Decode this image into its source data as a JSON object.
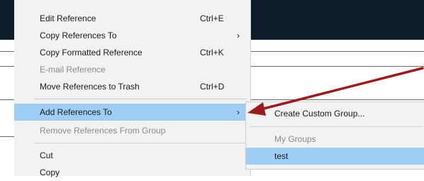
{
  "menu": {
    "items": [
      {
        "label": "Edit Reference",
        "shortcut": "Ctrl+E"
      },
      {
        "label": "Copy References To",
        "arrow": "›"
      },
      {
        "label": "Copy Formatted Reference",
        "shortcut": "Ctrl+K"
      },
      {
        "label": "E-mail Reference"
      },
      {
        "label": "Move References to Trash",
        "shortcut": "Ctrl+D"
      },
      {
        "label": "Add References To",
        "arrow": "›"
      },
      {
        "label": "Remove References From Group"
      },
      {
        "label": "Cut"
      },
      {
        "label": "Copy"
      }
    ]
  },
  "submenu": {
    "items": [
      {
        "label": "Create Custom Group..."
      },
      {
        "label": "My Groups"
      },
      {
        "label": "test"
      }
    ]
  },
  "colors": {
    "highlight": "#9fcdf3",
    "annotation_arrow": "#9b1c1c",
    "header_bar": "#0d1b2a"
  }
}
